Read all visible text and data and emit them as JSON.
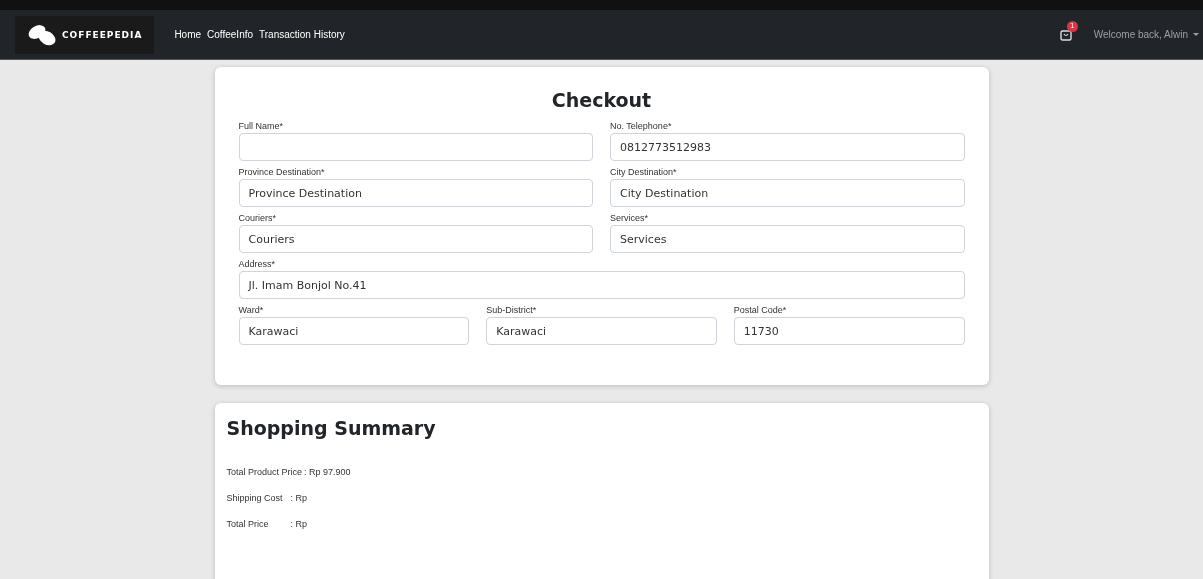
{
  "navbar": {
    "brand": "COFFEEPEDIA",
    "links": [
      {
        "label": "Home"
      },
      {
        "label": "CoffeeInfo"
      },
      {
        "label": "Transaction History"
      }
    ],
    "cart_badge": "1",
    "user_menu": "Welcome back, Alwin"
  },
  "checkout": {
    "title": "Checkout",
    "rows": [
      {
        "fields": [
          {
            "label": "Full Name*"
          },
          {
            "label": "No. Telephone*",
            "value": "0812773512983"
          }
        ]
      },
      {
        "fields": [
          {
            "label": "Province Destination*",
            "value": "Province Destination"
          },
          {
            "label": "City Destination*",
            "value": "City Destination"
          }
        ]
      },
      {
        "fields": [
          {
            "label": "Couriers*",
            "value": "Couriers"
          },
          {
            "label": "Services*",
            "value": "Services"
          }
        ]
      },
      {
        "fields": [
          {
            "label": "Address*",
            "value": "Jl. Imam Bonjol No.41"
          }
        ]
      },
      {
        "fields": [
          {
            "label": "Ward*",
            "value": "Karawaci"
          },
          {
            "label": "Sub-District*",
            "value": "Karawaci"
          },
          {
            "label": "Postal Code*",
            "value": "11730"
          }
        ]
      }
    ]
  },
  "summary": {
    "title": "Shopping Summary",
    "lines": [
      {
        "label": "Total Product Price",
        "value": ": Rp 97.900"
      },
      {
        "label": "Shipping Cost",
        "value": ": Rp"
      },
      {
        "label": "Total Price",
        "value": ": Rp"
      }
    ]
  }
}
